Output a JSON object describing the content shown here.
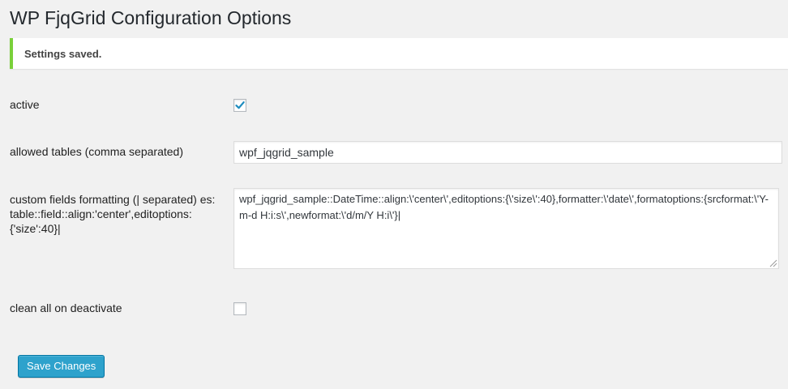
{
  "page": {
    "title": "WP FjqGrid Configuration Options"
  },
  "notice": {
    "text": "Settings saved."
  },
  "form": {
    "active": {
      "label": "active",
      "checked": true
    },
    "allowed_tables": {
      "label": "allowed tables (comma separated)",
      "value": "wpf_jqgrid_sample"
    },
    "custom_fields": {
      "label": "custom fields formatting (| separated) es: table::field::align:'center',editoptions:{'size':40}|",
      "value": "wpf_jqgrid_sample::DateTime::align:\\'center\\',editoptions:{\\'size\\':40},formatter:\\'date\\',formatoptions:{srcformat:\\'Y-m-d H:i:s\\',newformat:\\'d/m/Y H:i\\'}|"
    },
    "clean_on_deactivate": {
      "label": "clean all on deactivate",
      "checked": false
    }
  },
  "actions": {
    "save_label": "Save Changes"
  },
  "colors": {
    "notice_border": "#7ad03a",
    "button_bg": "#2ea2cc",
    "check_color": "#1e8cbe"
  }
}
